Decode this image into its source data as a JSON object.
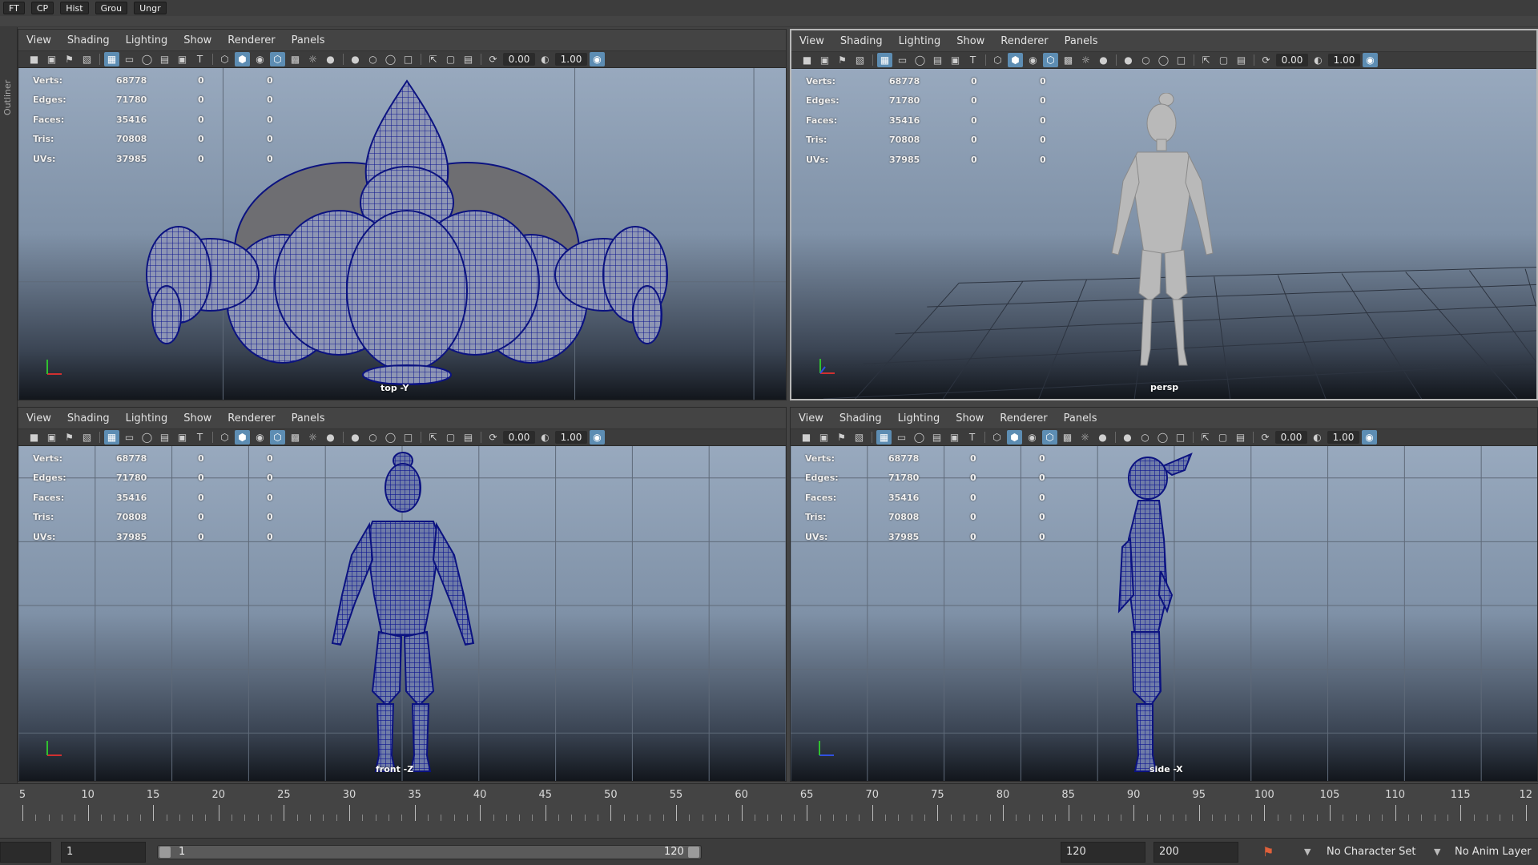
{
  "shelf": {
    "buttons": [
      "FT",
      "CP",
      "Hist",
      "Grou",
      "Ungr"
    ]
  },
  "outliner_tab": {
    "label": "Outliner"
  },
  "panel_menus": [
    "View",
    "Shading",
    "Lighting",
    "Show",
    "Renderer",
    "Panels"
  ],
  "toolbar_values": {
    "near": "0.00",
    "far": "1.00"
  },
  "hud_rows": [
    {
      "label": "Verts:",
      "total": "68778",
      "sel1": "0",
      "sel2": "0"
    },
    {
      "label": "Edges:",
      "total": "71780",
      "sel1": "0",
      "sel2": "0"
    },
    {
      "label": "Faces:",
      "total": "35416",
      "sel1": "0",
      "sel2": "0"
    },
    {
      "label": "Tris:",
      "total": "70808",
      "sel1": "0",
      "sel2": "0"
    },
    {
      "label": "UVs:",
      "total": "37985",
      "sel1": "0",
      "sel2": "0"
    }
  ],
  "panes": {
    "top": {
      "camera": "top -Y"
    },
    "persp": {
      "camera": "persp"
    },
    "front": {
      "camera": "front -Z"
    },
    "side": {
      "camera": "side -X"
    }
  },
  "timeline": {
    "ticks": [
      "5",
      "10",
      "15",
      "20",
      "25",
      "30",
      "35",
      "40",
      "45",
      "50",
      "55",
      "60",
      "65",
      "70",
      "75",
      "80",
      "85",
      "90",
      "95",
      "100",
      "105",
      "110",
      "115",
      "12"
    ]
  },
  "range": {
    "current_frame": "1",
    "range_start": "1",
    "range_end": "120",
    "end_time": "120",
    "anim_end": "200",
    "character_set": "No Character Set",
    "anim_layer": "No Anim Layer"
  },
  "colors": {
    "wire": "#101890",
    "active_toggle": "#5d8db3",
    "gray_model": "#b9b9b9"
  }
}
